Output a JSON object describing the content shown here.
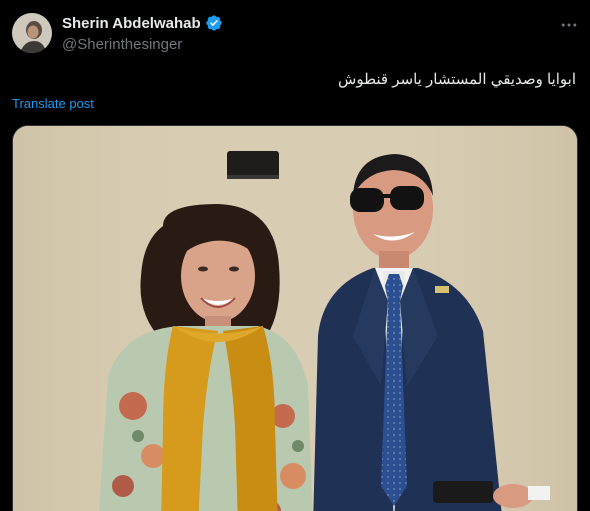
{
  "author": {
    "display_name": "Sherin Abdelwahab",
    "handle": "@Sherinthesinger",
    "verified": true,
    "avatar_icon": "avatar-photo"
  },
  "post": {
    "text": "ابوايا وصديقي المستشار ياسر قنطوش",
    "translate_label": "Translate post"
  },
  "icons": {
    "verified": "verified-badge-icon",
    "more": "more-options-icon"
  },
  "colors": {
    "background": "#000000",
    "text_primary": "#e7e9ea",
    "text_secondary": "#71767b",
    "accent": "#1d9bf0"
  }
}
